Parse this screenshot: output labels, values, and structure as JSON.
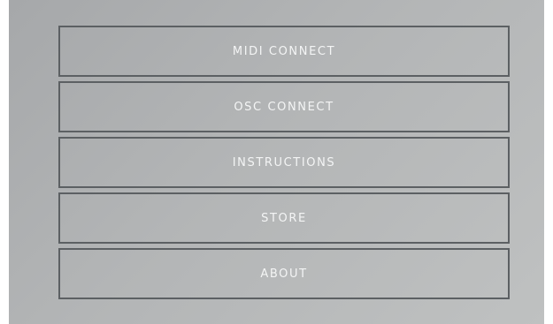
{
  "menu": {
    "items": [
      {
        "label": "MIDI CONNECT"
      },
      {
        "label": "OSC CONNECT"
      },
      {
        "label": "INSTRUCTIONS"
      },
      {
        "label": "STORE"
      },
      {
        "label": "ABOUT"
      }
    ]
  },
  "colors": {
    "background": "#b3b5b6",
    "button_border": "#5c6063",
    "label_text": "#f4f5f5"
  }
}
